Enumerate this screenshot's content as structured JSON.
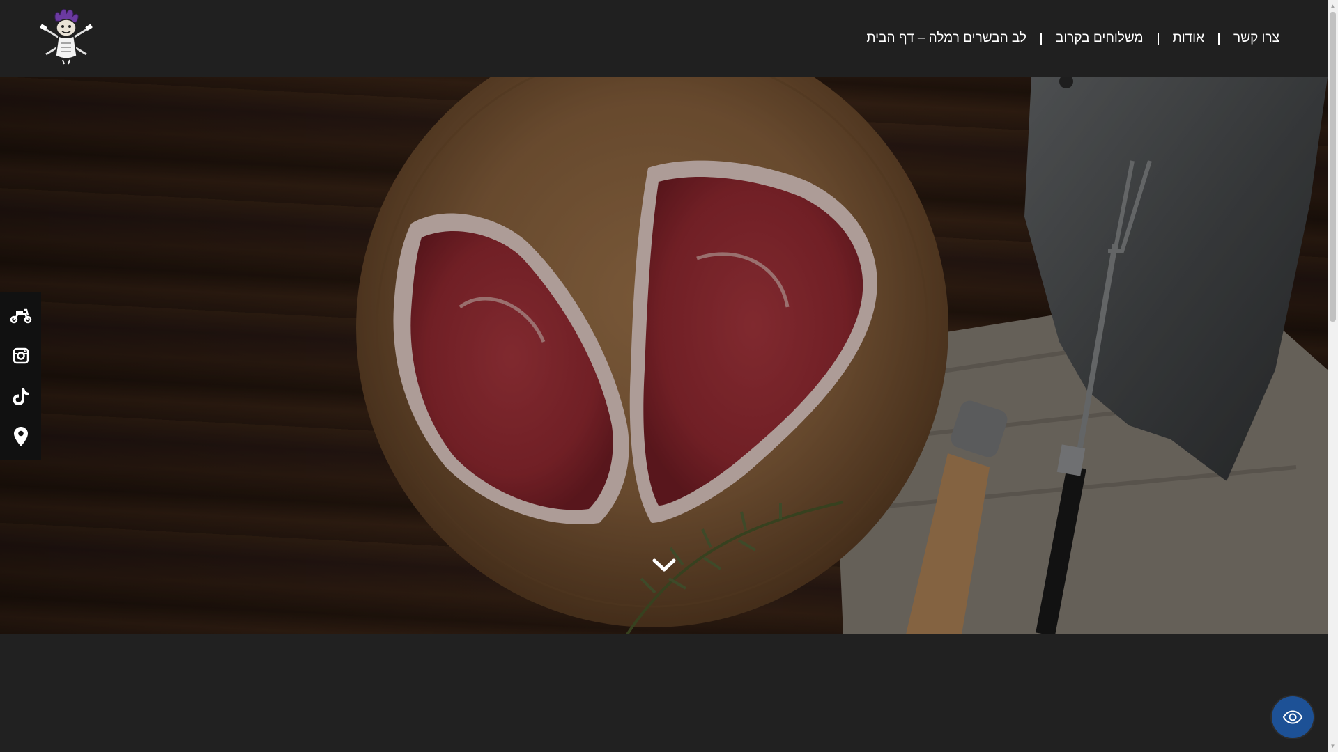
{
  "header": {
    "logo_icon": "chef-mascot-logo",
    "nav": [
      {
        "label": "לב הבשרים רמלה – דף הבית"
      },
      {
        "label": "משלוחים בקרוב"
      },
      {
        "label": "אודות"
      },
      {
        "label": "צרו קשר"
      }
    ]
  },
  "hero": {
    "image": "raw-steaks-heart-on-wooden-board-with-cleaver-and-fork",
    "scroll_icon": "chevron-down-icon"
  },
  "sidebar": {
    "items": [
      {
        "icon": "scooter-delivery-icon"
      },
      {
        "icon": "instagram-icon"
      },
      {
        "icon": "tiktok-icon"
      },
      {
        "icon": "location-pin-icon"
      }
    ]
  },
  "accessibility": {
    "icon": "eye-icon",
    "color": "#1d5196"
  },
  "colors": {
    "header_bg": "#202020",
    "sidebar_bg": "#111111",
    "page_bg": "#212121"
  }
}
